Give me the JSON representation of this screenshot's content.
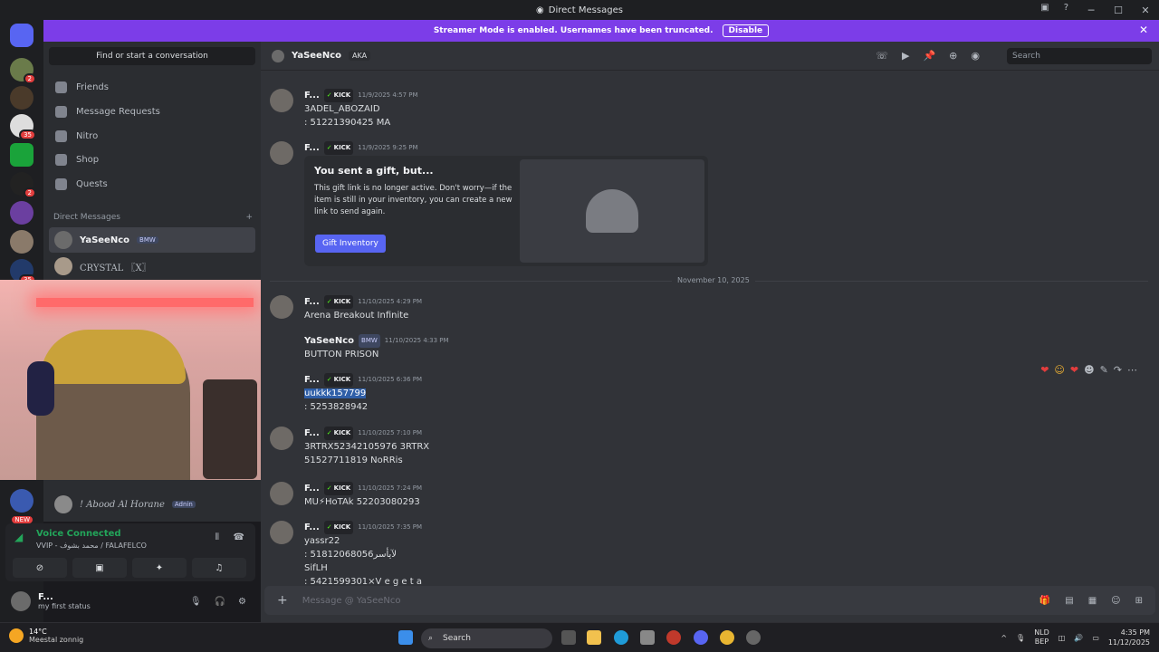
{
  "window": {
    "title": "Direct Messages"
  },
  "banner": {
    "text": "Streamer Mode is enabled. Usernames have been truncated.",
    "disable": "Disable"
  },
  "sidebar": {
    "find": "Find or start a conversation",
    "nav": [
      {
        "label": "Friends",
        "icon": "friends-icon"
      },
      {
        "label": "Message Requests",
        "icon": "mail-icon"
      },
      {
        "label": "Nitro",
        "icon": "nitro-icon"
      },
      {
        "label": "Shop",
        "icon": "shop-icon"
      },
      {
        "label": "Quests",
        "icon": "quests-icon"
      }
    ],
    "dm_header": "Direct Messages",
    "dms": [
      {
        "name": "YaSeeNco",
        "tag": "BMW"
      },
      {
        "name": "CRYSTAL 〖X〗"
      },
      {
        "name": "! Abood Al Horane",
        "tag": "Adnin"
      }
    ]
  },
  "guild_badges": [
    "2",
    "35",
    "2",
    "35"
  ],
  "guild_new": "NEW",
  "voice": {
    "status": "Voice Connected",
    "channel": "VVIP - محمد بشوف / FALAFELCO"
  },
  "user": {
    "name": "F...",
    "status": "my first status"
  },
  "chat_header": {
    "name": "YaSeeNco",
    "aka": "AKA",
    "search": "Search"
  },
  "messages": [
    {
      "author": "F...",
      "badge": "KICK",
      "time": "11/9/2025 4:57 PM",
      "lines": [
        "3ADEL_ABOZAID",
        ": 51221390425 MA"
      ]
    },
    {
      "author": "F...",
      "badge": "KICK",
      "time": "11/9/2025 9:25 PM",
      "lines": []
    },
    {
      "author": "F...",
      "badge": "KICK",
      "time": "11/10/2025 4:29 PM",
      "lines": [
        "Arena Breakout Infinite"
      ]
    },
    {
      "author": "YaSeeNco",
      "badge": "BMW",
      "time": "11/10/2025 4:33 PM",
      "lines": [
        "BUTTON PRISON"
      ]
    },
    {
      "author": "F...",
      "badge": "KICK",
      "time": "11/10/2025 6:36 PM",
      "lines": [
        "uukkk157799",
        ": 5253828942"
      ]
    },
    {
      "author": "F...",
      "badge": "KICK",
      "time": "11/10/2025 7:10 PM",
      "lines": [
        "3RTRX52342105976 3RTRX",
        "51527711819 NoRRis"
      ]
    },
    {
      "author": "F...",
      "badge": "KICK",
      "time": "11/10/2025 7:24 PM",
      "lines": [
        "MU⚡HoTAk 52203080293"
      ]
    },
    {
      "author": "F...",
      "badge": "KICK",
      "time": "11/10/2025 7:35 PM",
      "lines": [
        "yassr22",
        ": 51812068056لآيأسر",
        "SifLH",
        ": 5421599301×V e g e t a"
      ]
    }
  ],
  "gift": {
    "title": "You sent a gift, but...",
    "desc": "This gift link is no longer active. Don't worry—if the item is still in your inventory, you can create a new link to send again.",
    "button": "Gift Inventory"
  },
  "divider": "November 10, 2025",
  "composer": {
    "placeholder": "Message @ YaSeeNco"
  },
  "taskbar": {
    "temp": "14°C",
    "weather": "Meestal zonnig",
    "search": "Search",
    "lang1": "NLD",
    "lang2": "BEP",
    "time": "4:35 PM",
    "date": "11/12/2025"
  }
}
